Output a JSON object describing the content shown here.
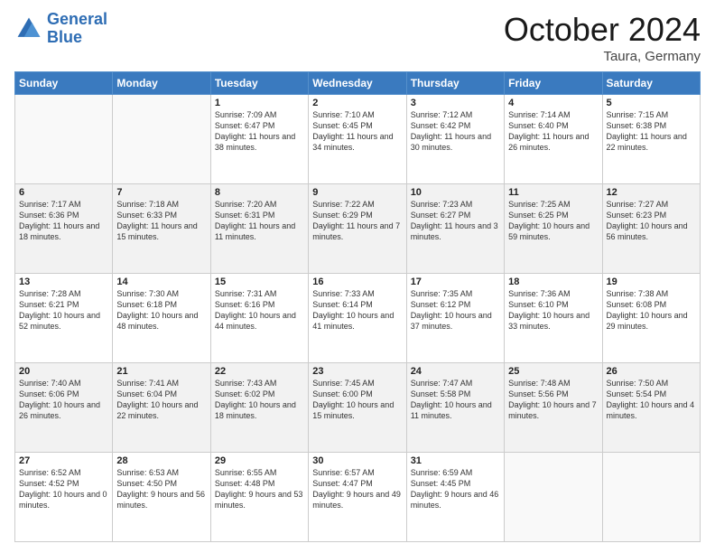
{
  "header": {
    "logo_line1": "General",
    "logo_line2": "Blue",
    "month_title": "October 2024",
    "location": "Taura, Germany"
  },
  "weekdays": [
    "Sunday",
    "Monday",
    "Tuesday",
    "Wednesday",
    "Thursday",
    "Friday",
    "Saturday"
  ],
  "rows": [
    [
      {
        "day": "",
        "sunrise": "",
        "sunset": "",
        "daylight": ""
      },
      {
        "day": "",
        "sunrise": "",
        "sunset": "",
        "daylight": ""
      },
      {
        "day": "1",
        "sunrise": "Sunrise: 7:09 AM",
        "sunset": "Sunset: 6:47 PM",
        "daylight": "Daylight: 11 hours and 38 minutes."
      },
      {
        "day": "2",
        "sunrise": "Sunrise: 7:10 AM",
        "sunset": "Sunset: 6:45 PM",
        "daylight": "Daylight: 11 hours and 34 minutes."
      },
      {
        "day": "3",
        "sunrise": "Sunrise: 7:12 AM",
        "sunset": "Sunset: 6:42 PM",
        "daylight": "Daylight: 11 hours and 30 minutes."
      },
      {
        "day": "4",
        "sunrise": "Sunrise: 7:14 AM",
        "sunset": "Sunset: 6:40 PM",
        "daylight": "Daylight: 11 hours and 26 minutes."
      },
      {
        "day": "5",
        "sunrise": "Sunrise: 7:15 AM",
        "sunset": "Sunset: 6:38 PM",
        "daylight": "Daylight: 11 hours and 22 minutes."
      }
    ],
    [
      {
        "day": "6",
        "sunrise": "Sunrise: 7:17 AM",
        "sunset": "Sunset: 6:36 PM",
        "daylight": "Daylight: 11 hours and 18 minutes."
      },
      {
        "day": "7",
        "sunrise": "Sunrise: 7:18 AM",
        "sunset": "Sunset: 6:33 PM",
        "daylight": "Daylight: 11 hours and 15 minutes."
      },
      {
        "day": "8",
        "sunrise": "Sunrise: 7:20 AM",
        "sunset": "Sunset: 6:31 PM",
        "daylight": "Daylight: 11 hours and 11 minutes."
      },
      {
        "day": "9",
        "sunrise": "Sunrise: 7:22 AM",
        "sunset": "Sunset: 6:29 PM",
        "daylight": "Daylight: 11 hours and 7 minutes."
      },
      {
        "day": "10",
        "sunrise": "Sunrise: 7:23 AM",
        "sunset": "Sunset: 6:27 PM",
        "daylight": "Daylight: 11 hours and 3 minutes."
      },
      {
        "day": "11",
        "sunrise": "Sunrise: 7:25 AM",
        "sunset": "Sunset: 6:25 PM",
        "daylight": "Daylight: 10 hours and 59 minutes."
      },
      {
        "day": "12",
        "sunrise": "Sunrise: 7:27 AM",
        "sunset": "Sunset: 6:23 PM",
        "daylight": "Daylight: 10 hours and 56 minutes."
      }
    ],
    [
      {
        "day": "13",
        "sunrise": "Sunrise: 7:28 AM",
        "sunset": "Sunset: 6:21 PM",
        "daylight": "Daylight: 10 hours and 52 minutes."
      },
      {
        "day": "14",
        "sunrise": "Sunrise: 7:30 AM",
        "sunset": "Sunset: 6:18 PM",
        "daylight": "Daylight: 10 hours and 48 minutes."
      },
      {
        "day": "15",
        "sunrise": "Sunrise: 7:31 AM",
        "sunset": "Sunset: 6:16 PM",
        "daylight": "Daylight: 10 hours and 44 minutes."
      },
      {
        "day": "16",
        "sunrise": "Sunrise: 7:33 AM",
        "sunset": "Sunset: 6:14 PM",
        "daylight": "Daylight: 10 hours and 41 minutes."
      },
      {
        "day": "17",
        "sunrise": "Sunrise: 7:35 AM",
        "sunset": "Sunset: 6:12 PM",
        "daylight": "Daylight: 10 hours and 37 minutes."
      },
      {
        "day": "18",
        "sunrise": "Sunrise: 7:36 AM",
        "sunset": "Sunset: 6:10 PM",
        "daylight": "Daylight: 10 hours and 33 minutes."
      },
      {
        "day": "19",
        "sunrise": "Sunrise: 7:38 AM",
        "sunset": "Sunset: 6:08 PM",
        "daylight": "Daylight: 10 hours and 29 minutes."
      }
    ],
    [
      {
        "day": "20",
        "sunrise": "Sunrise: 7:40 AM",
        "sunset": "Sunset: 6:06 PM",
        "daylight": "Daylight: 10 hours and 26 minutes."
      },
      {
        "day": "21",
        "sunrise": "Sunrise: 7:41 AM",
        "sunset": "Sunset: 6:04 PM",
        "daylight": "Daylight: 10 hours and 22 minutes."
      },
      {
        "day": "22",
        "sunrise": "Sunrise: 7:43 AM",
        "sunset": "Sunset: 6:02 PM",
        "daylight": "Daylight: 10 hours and 18 minutes."
      },
      {
        "day": "23",
        "sunrise": "Sunrise: 7:45 AM",
        "sunset": "Sunset: 6:00 PM",
        "daylight": "Daylight: 10 hours and 15 minutes."
      },
      {
        "day": "24",
        "sunrise": "Sunrise: 7:47 AM",
        "sunset": "Sunset: 5:58 PM",
        "daylight": "Daylight: 10 hours and 11 minutes."
      },
      {
        "day": "25",
        "sunrise": "Sunrise: 7:48 AM",
        "sunset": "Sunset: 5:56 PM",
        "daylight": "Daylight: 10 hours and 7 minutes."
      },
      {
        "day": "26",
        "sunrise": "Sunrise: 7:50 AM",
        "sunset": "Sunset: 5:54 PM",
        "daylight": "Daylight: 10 hours and 4 minutes."
      }
    ],
    [
      {
        "day": "27",
        "sunrise": "Sunrise: 6:52 AM",
        "sunset": "Sunset: 4:52 PM",
        "daylight": "Daylight: 10 hours and 0 minutes."
      },
      {
        "day": "28",
        "sunrise": "Sunrise: 6:53 AM",
        "sunset": "Sunset: 4:50 PM",
        "daylight": "Daylight: 9 hours and 56 minutes."
      },
      {
        "day": "29",
        "sunrise": "Sunrise: 6:55 AM",
        "sunset": "Sunset: 4:48 PM",
        "daylight": "Daylight: 9 hours and 53 minutes."
      },
      {
        "day": "30",
        "sunrise": "Sunrise: 6:57 AM",
        "sunset": "Sunset: 4:47 PM",
        "daylight": "Daylight: 9 hours and 49 minutes."
      },
      {
        "day": "31",
        "sunrise": "Sunrise: 6:59 AM",
        "sunset": "Sunset: 4:45 PM",
        "daylight": "Daylight: 9 hours and 46 minutes."
      },
      {
        "day": "",
        "sunrise": "",
        "sunset": "",
        "daylight": ""
      },
      {
        "day": "",
        "sunrise": "",
        "sunset": "",
        "daylight": ""
      }
    ]
  ]
}
